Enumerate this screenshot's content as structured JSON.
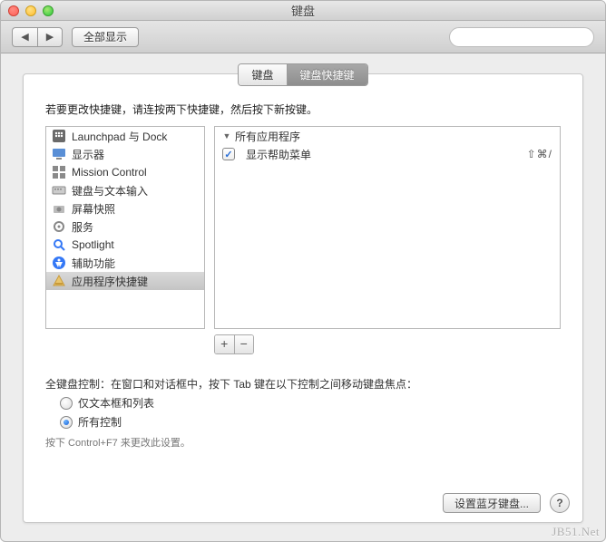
{
  "window": {
    "title": "键盘"
  },
  "toolbar": {
    "back_icon": "◀",
    "forward_icon": "▶",
    "show_all": "全部显示",
    "search_placeholder": ""
  },
  "tabs": {
    "keyboard": "键盘",
    "shortcuts": "键盘快捷键"
  },
  "panel": {
    "instruction": "若要更改快捷键，请连按两下快捷键，然后按下新按键。",
    "categories": [
      {
        "label": "Launchpad 与 Dock",
        "icon": "launchpad"
      },
      {
        "label": "显示器",
        "icon": "display"
      },
      {
        "label": "Mission Control",
        "icon": "mission"
      },
      {
        "label": "键盘与文本输入",
        "icon": "keyboard"
      },
      {
        "label": "屏幕快照",
        "icon": "screenshot"
      },
      {
        "label": "服务",
        "icon": "services"
      },
      {
        "label": "Spotlight",
        "icon": "spotlight"
      },
      {
        "label": "辅助功能",
        "icon": "accessibility"
      },
      {
        "label": "应用程序快捷键",
        "icon": "appshortcuts",
        "selected": true
      }
    ],
    "right": {
      "group": "所有应用程序",
      "items": [
        {
          "label": "显示帮助菜单",
          "checked": true,
          "shortcut": "⇧⌘/"
        }
      ]
    },
    "add": "+",
    "remove": "−"
  },
  "fka": {
    "title": "全键盘控制：在窗口和对话框中，按下 Tab 键在以下控制之间移动键盘焦点：",
    "opt_textboxes": "仅文本框和列表",
    "opt_all": "所有控制",
    "note": "按下 Control+F7 来更改此设置。"
  },
  "footer": {
    "bluetooth": "设置蓝牙键盘...",
    "help": "?"
  },
  "watermark": "JB51.Net"
}
